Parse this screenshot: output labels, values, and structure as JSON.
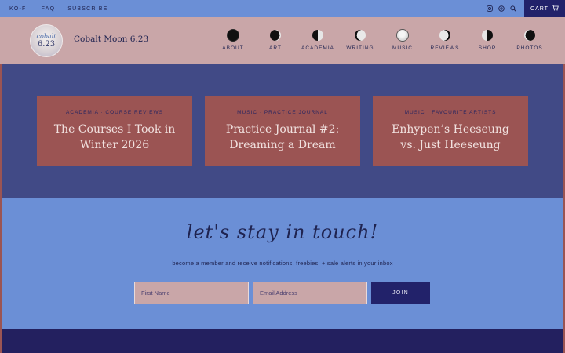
{
  "topbar": {
    "links": [
      "KO-FI",
      "FAQ",
      "SUBSCRIBE"
    ],
    "social_icons": [
      "instagram-icon",
      "threads-icon",
      "search-icon"
    ],
    "cart_label": "CART"
  },
  "header": {
    "logo_line1": "cobalt",
    "logo_line2": "6.23",
    "site_title": "Cobalt Moon 6.23",
    "nav": [
      {
        "label": "ABOUT",
        "icon": "new-moon-icon"
      },
      {
        "label": "ART",
        "icon": "crescent-moon-icon"
      },
      {
        "label": "ACADEMIA",
        "icon": "first-quarter-moon-icon"
      },
      {
        "label": "WRITING",
        "icon": "waxing-gibbous-moon-icon"
      },
      {
        "label": "MUSIC",
        "icon": "full-moon-icon"
      },
      {
        "label": "REVIEWS",
        "icon": "waning-gibbous-moon-icon"
      },
      {
        "label": "SHOP",
        "icon": "last-quarter-moon-icon"
      },
      {
        "label": "PHOTOS",
        "icon": "waning-crescent-moon-icon"
      }
    ]
  },
  "posts": [
    {
      "category": "ACADEMIA · COURSE REVIEWS",
      "title": "The Courses I Took in Winter 2026"
    },
    {
      "category": "MUSIC · PRACTICE JOURNAL",
      "title": "Practice Journal #2: Dreaming a Dream"
    },
    {
      "category": "MUSIC · FAVOURITE ARTISTS",
      "title": "Enhypen’s Heeseung vs. Just Heeseung"
    }
  ],
  "newsletter": {
    "heading": "let's stay in touch!",
    "subtext": "become a member and receive notifications, freebies, + sale alerts in your inbox",
    "first_name_placeholder": "First Name",
    "email_placeholder": "Email Address",
    "join_label": "JOIN"
  },
  "colors": {
    "primary_blue": "#6b8fd6",
    "navy": "#22226a",
    "dusty_pink": "#c9a6a8",
    "card_red": "#9b5453",
    "posts_bg": "#414a86"
  }
}
